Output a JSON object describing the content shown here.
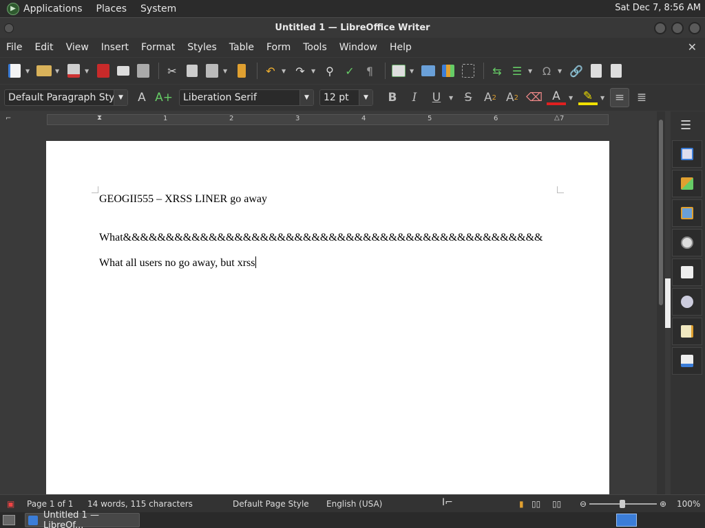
{
  "system_panel": {
    "menus": [
      "Applications",
      "Places",
      "System"
    ],
    "clock": "Sat Dec 7,  8:56 AM"
  },
  "window": {
    "title": "Untitled 1 — LibreOffice Writer"
  },
  "menubar": {
    "items": [
      "File",
      "Edit",
      "View",
      "Insert",
      "Format",
      "Styles",
      "Table",
      "Form",
      "Tools",
      "Window",
      "Help"
    ],
    "close_symbol": "✕"
  },
  "formatting": {
    "paragraph_style": "Default Paragraph Style",
    "font_name": "Liberation Serif",
    "font_size": "12 pt"
  },
  "ruler": {
    "numbers": [
      "1",
      "2",
      "3",
      "4",
      "5",
      "6",
      "7"
    ]
  },
  "document": {
    "paragraphs": [
      "GEOGII555 – XRSS LINER go away",
      "What&&&&&&&&&&&&&&&&&&&&&&&&&&&&&&&&&&&&&&&&&&&&&&&&&",
      "What all users no go away, but xrss"
    ]
  },
  "statusbar": {
    "page": "Page 1 of 1",
    "words": "14 words, 115 characters",
    "page_style": "Default Page Style",
    "language": "English (USA)",
    "zoom": "100%"
  },
  "taskbar": {
    "task_label": "Untitled 1 — LibreOf..."
  },
  "colors": {
    "accent_blue": "#3b7dd8",
    "font_color_red": "#e02020",
    "highlight_yellow": "#f0e000"
  }
}
